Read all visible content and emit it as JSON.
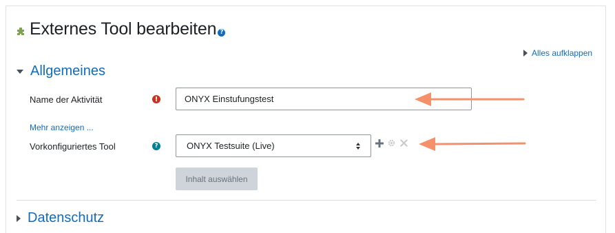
{
  "page": {
    "title": "Externes Tool bearbeiten",
    "title_help_glyph": "?",
    "expand_all_label": "Alles aufklappen"
  },
  "sections": {
    "general": {
      "label": "Allgemeines",
      "state": "expanded"
    },
    "privacy": {
      "label": "Datenschutz",
      "state": "collapsed"
    }
  },
  "form": {
    "activity_name": {
      "label": "Name der Aktivität",
      "value": "ONYX Einstufungstest",
      "required_glyph": "!"
    },
    "show_more_label": "Mehr anzeigen ...",
    "preconfigured_tool": {
      "label": "Vorkonfiguriertes Tool",
      "selected": "ONYX Testsuite (Live)",
      "help_glyph": "?",
      "action_icons": [
        "plus-icon",
        "gear-icon",
        "close-icon"
      ]
    },
    "select_content_button": "Inhalt auswählen"
  },
  "annotations": {
    "arrow_color": "#f4916a",
    "targets": [
      "activity-name-input",
      "preconfigured-tool-select"
    ]
  },
  "colors": {
    "link": "#0f6cbf",
    "required": "#ca3120",
    "help": "#008196",
    "puzzle": "#7fa350",
    "button_bg": "#ced4da"
  }
}
